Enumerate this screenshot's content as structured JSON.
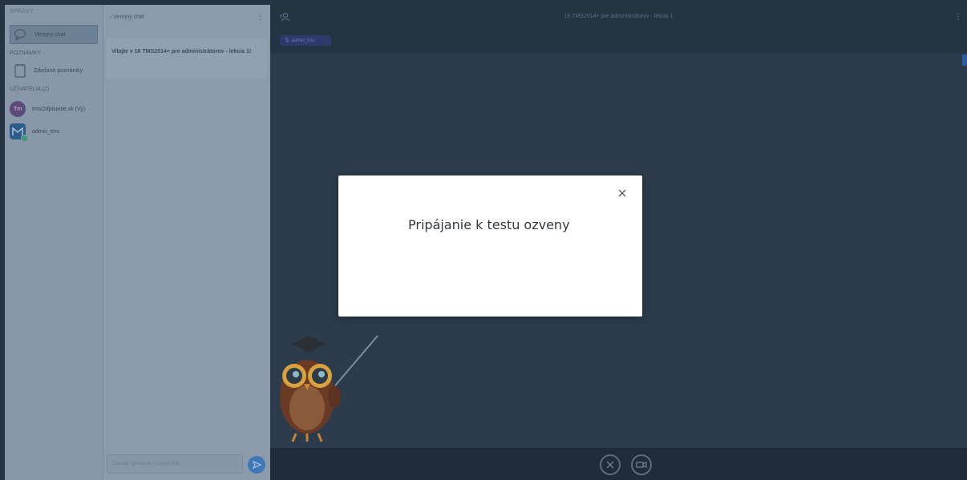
{
  "sidebar": {
    "messages_heading": "SPRÁVY",
    "public_chat_label": "Verejný chat",
    "notes_heading": "POZNÁMKY",
    "shared_notes_label": "Zdieľané poznámky",
    "users_heading": "UŽÍVATELIA (2)",
    "users": [
      {
        "initials": "Tm",
        "name": "tmsОdpisanie.sk (Vy)"
      },
      {
        "initials": "",
        "name": "admin_tms"
      }
    ]
  },
  "chat": {
    "back_label": "‹  Verejný chat",
    "welcome_text": "Vitajte v 16 TMS2014+ pre administrátorov - lekcia 1!",
    "input_placeholder": "Odoslať správu do Verejný chat"
  },
  "stage": {
    "title": "16 TMS2014+ pre administrátorov - lekcia 1",
    "user_badge": "admin_tms"
  },
  "modal": {
    "title": "Pripájanie k testu ozveny"
  },
  "colors": {
    "modal_bg": "#ffffff",
    "accent": "#3e78b6"
  }
}
